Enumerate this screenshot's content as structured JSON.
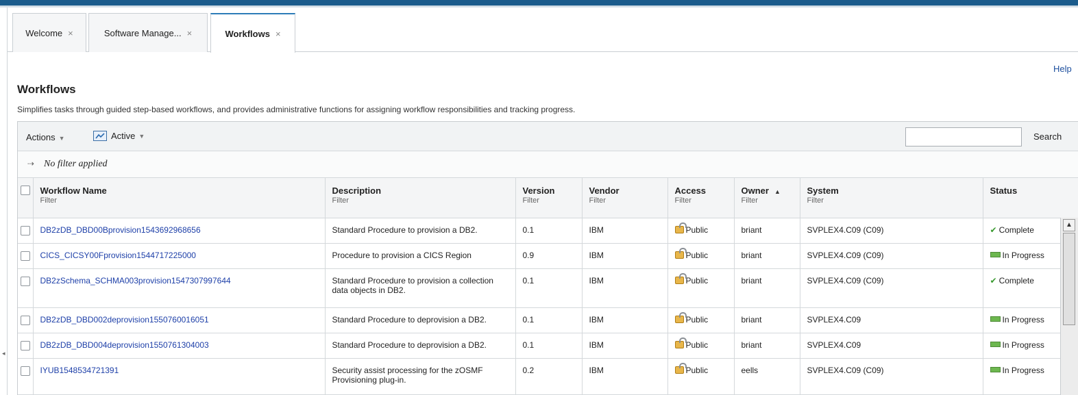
{
  "tabs": [
    {
      "label": "Welcome",
      "close": "×"
    },
    {
      "label": "Software Manage...",
      "close": "×"
    },
    {
      "label": "Workflows",
      "close": "×"
    }
  ],
  "help_link": "Help",
  "page": {
    "title": "Workflows",
    "subtitle": "Simplifies tasks through guided step-based workflows, and provides administrative functions for assigning workflow responsibilities and tracking progress."
  },
  "toolbar": {
    "actions_label": "Actions",
    "view_label": "Active",
    "search_label": "Search",
    "search_value": ""
  },
  "filter": {
    "text": "No filter applied"
  },
  "columns": [
    {
      "label": "Workflow Name",
      "filter": "Filter"
    },
    {
      "label": "Description",
      "filter": "Filter"
    },
    {
      "label": "Version",
      "filter": "Filter"
    },
    {
      "label": "Vendor",
      "filter": "Filter"
    },
    {
      "label": "Access",
      "filter": "Filter"
    },
    {
      "label": "Owner",
      "filter": "Filter",
      "sorted": "ascending"
    },
    {
      "label": "System",
      "filter": "Filter"
    },
    {
      "label": "Status",
      "filter": ""
    }
  ],
  "rows": [
    {
      "name": "DB2zDB_DBD00Bprovision1543692968656",
      "description": "Standard Procedure to provision a DB2.",
      "version": "0.1",
      "vendor": "IBM",
      "access": "Public",
      "owner": "briant",
      "system": "SVPLEX4.C09 (C09)",
      "status": "Complete"
    },
    {
      "name": "CICS_CICSY00Fprovision1544717225000",
      "description": "Procedure to provision a CICS Region",
      "version": "0.9",
      "vendor": "IBM",
      "access": "Public",
      "owner": "briant",
      "system": "SVPLEX4.C09 (C09)",
      "status": "In Progress"
    },
    {
      "name": "DB2zSchema_SCHMA003provision1547307997644",
      "description": "Standard Procedure to provision a collection data objects in DB2.",
      "version": "0.1",
      "vendor": "IBM",
      "access": "Public",
      "owner": "briant",
      "system": "SVPLEX4.C09 (C09)",
      "status": "Complete"
    },
    {
      "name": "DB2zDB_DBD002deprovision1550760016051",
      "description": "Standard Procedure to deprovision a DB2.",
      "version": "0.1",
      "vendor": "IBM",
      "access": "Public",
      "owner": "briant",
      "system": "SVPLEX4.C09",
      "status": "In Progress"
    },
    {
      "name": "DB2zDB_DBD004deprovision1550761304003",
      "description": "Standard Procedure to deprovision a DB2.",
      "version": "0.1",
      "vendor": "IBM",
      "access": "Public",
      "owner": "briant",
      "system": "SVPLEX4.C09",
      "status": "In Progress"
    },
    {
      "name": "IYUB1548534721391",
      "description": "Security assist processing for the zOSMF Provisioning plug-in.",
      "version": "0.2",
      "vendor": "IBM",
      "access": "Public",
      "owner": "eells",
      "system": "SVPLEX4.C09 (C09)",
      "status": "In Progress"
    }
  ]
}
